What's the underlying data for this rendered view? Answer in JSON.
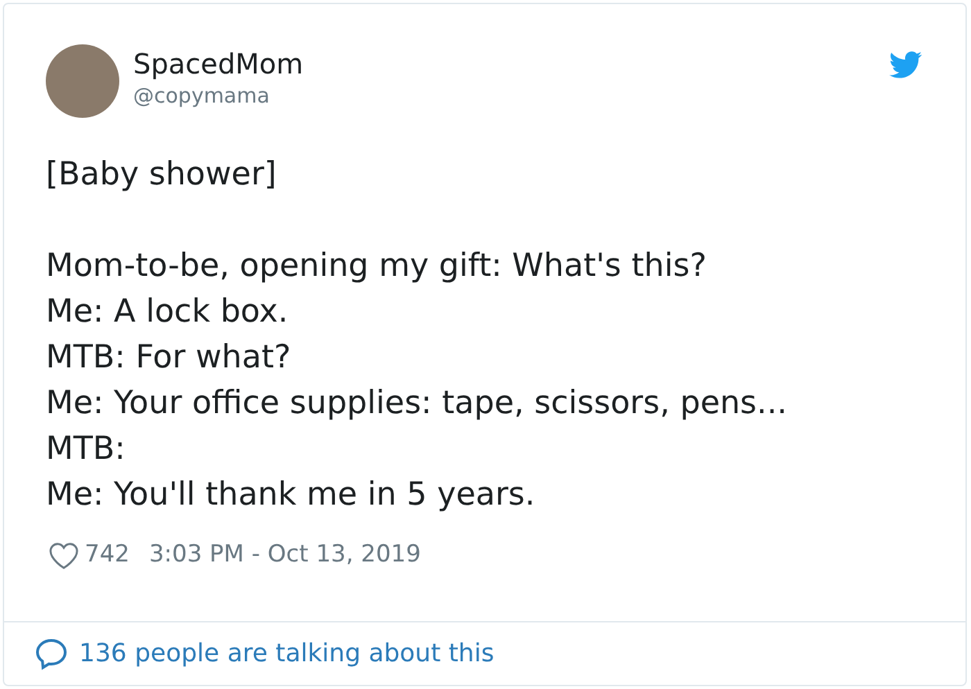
{
  "author": {
    "name": "SpacedMom",
    "handle": "@copymama"
  },
  "paragraphs": [
    [
      "[Baby shower]"
    ],
    [
      "Mom-to-be, opening my gift: What's this?",
      "Me: A lock box.",
      "MTB: For what?",
      "Me: Your office supplies: tape, scissors, pens...",
      "MTB:",
      "Me: You'll thank me in 5 years."
    ]
  ],
  "likes": "742",
  "timestamp": "3:03 PM - Oct 13, 2019",
  "footer": "136 people are talking about this"
}
